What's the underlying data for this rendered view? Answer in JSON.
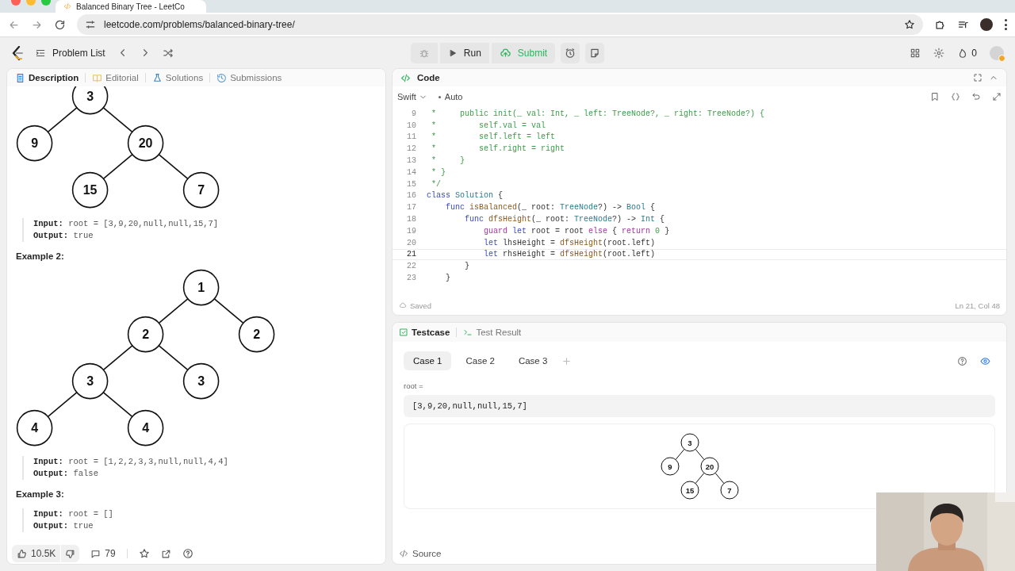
{
  "browser": {
    "tab_title": "Balanced Binary Tree - LeetCo",
    "url": "leetcode.com/problems/balanced-binary-tree/"
  },
  "navbar": {
    "problem_list": "Problem List",
    "run": "Run",
    "submit": "Submit",
    "streak": "0"
  },
  "description": {
    "tabs": [
      {
        "label": "Description",
        "selected": true
      },
      {
        "label": "Editorial",
        "selected": false
      },
      {
        "label": "Solutions",
        "selected": false
      },
      {
        "label": "Submissions",
        "selected": false
      }
    ],
    "examples": [
      {
        "tree": {
          "value": "3",
          "children": [
            {
              "value": "9"
            },
            {
              "value": "20",
              "children": [
                {
                  "value": "15"
                },
                {
                  "value": "7"
                }
              ]
            }
          ]
        },
        "input_label": "Input:",
        "input": "root = [3,9,20,null,null,15,7]",
        "output_label": "Output:",
        "output": "true"
      },
      {
        "heading": "Example 2:",
        "tree": {
          "value": "1",
          "children": [
            {
              "value": "2",
              "children": [
                {
                  "value": "3",
                  "children": [
                    {
                      "value": "4"
                    },
                    {
                      "value": "4"
                    }
                  ]
                },
                {
                  "value": "3"
                }
              ]
            },
            {
              "value": "2"
            }
          ]
        },
        "input_label": "Input:",
        "input": "root = [1,2,2,3,3,null,null,4,4]",
        "output_label": "Output:",
        "output": "false"
      },
      {
        "heading": "Example 3:",
        "input_label": "Input:",
        "input": "root = []",
        "output_label": "Output:",
        "output": "true"
      }
    ],
    "likes": "10.5K",
    "comments": "79"
  },
  "editor": {
    "title": "Code",
    "language": "Swift",
    "mode": "Auto",
    "status": "Saved",
    "cursor": "Ln 21, Col 48",
    "lines": [
      {
        "number": "9",
        "current": false,
        "segments": [
          {
            "text": " *     public init(_ val: Int, _ left: TreeNode?, _ right: TreeNode?) {",
            "kind": "comment"
          }
        ]
      },
      {
        "number": "10",
        "current": false,
        "segments": [
          {
            "text": " *         self.val = val",
            "kind": "comment"
          }
        ]
      },
      {
        "number": "11",
        "current": false,
        "segments": [
          {
            "text": " *         self.left = left",
            "kind": "comment"
          }
        ]
      },
      {
        "number": "12",
        "current": false,
        "segments": [
          {
            "text": " *         self.right = right",
            "kind": "comment"
          }
        ]
      },
      {
        "number": "13",
        "current": false,
        "segments": [
          {
            "text": " *     }",
            "kind": "comment"
          }
        ]
      },
      {
        "number": "14",
        "current": false,
        "segments": [
          {
            "text": " * }",
            "kind": "comment"
          }
        ]
      },
      {
        "number": "15",
        "current": false,
        "segments": [
          {
            "text": " */",
            "kind": "comment"
          }
        ]
      },
      {
        "number": "16",
        "current": false,
        "segments": [
          {
            "text": "class",
            "kind": "keyword"
          },
          {
            "text": " Solution",
            "kind": "type"
          },
          {
            "text": " {",
            "kind": "plain"
          }
        ]
      },
      {
        "number": "17",
        "current": false,
        "segments": [
          {
            "text": "    func",
            "kind": "keyword"
          },
          {
            "text": " isBalanced",
            "kind": "function"
          },
          {
            "text": "(_ root: ",
            "kind": "plain"
          },
          {
            "text": "TreeNode",
            "kind": "type"
          },
          {
            "text": "?) -> ",
            "kind": "plain"
          },
          {
            "text": "Bool",
            "kind": "type"
          },
          {
            "text": " {",
            "kind": "plain"
          }
        ]
      },
      {
        "number": "18",
        "current": false,
        "segments": [
          {
            "text": "        func",
            "kind": "keyword"
          },
          {
            "text": " dfsHeight",
            "kind": "function"
          },
          {
            "text": "(_ root: ",
            "kind": "plain"
          },
          {
            "text": "TreeNode",
            "kind": "type"
          },
          {
            "text": "?) -> ",
            "kind": "plain"
          },
          {
            "text": "Int",
            "kind": "type"
          },
          {
            "text": " {",
            "kind": "plain"
          }
        ]
      },
      {
        "number": "19",
        "current": false,
        "segments": [
          {
            "text": "            guard",
            "kind": "control"
          },
          {
            "text": " let",
            "kind": "keyword"
          },
          {
            "text": " root = root ",
            "kind": "plain"
          },
          {
            "text": "else",
            "kind": "control"
          },
          {
            "text": " { ",
            "kind": "plain"
          },
          {
            "text": "return",
            "kind": "control"
          },
          {
            "text": " 0",
            "kind": "number"
          },
          {
            "text": " }",
            "kind": "plain"
          }
        ]
      },
      {
        "number": "20",
        "current": false,
        "segments": [
          {
            "text": "            let",
            "kind": "keyword"
          },
          {
            "text": " lhsHeight = ",
            "kind": "plain"
          },
          {
            "text": "dfsHeight",
            "kind": "function"
          },
          {
            "text": "(root.left)",
            "kind": "plain"
          }
        ]
      },
      {
        "number": "21",
        "current": true,
        "segments": [
          {
            "text": "            let",
            "kind": "keyword"
          },
          {
            "text": " rhsHeight = ",
            "kind": "plain"
          },
          {
            "text": "dfsHeight",
            "kind": "function"
          },
          {
            "text": "(root.left)",
            "kind": "plain"
          }
        ]
      },
      {
        "number": "22",
        "current": false,
        "segments": [
          {
            "text": "        }",
            "kind": "plain"
          }
        ]
      },
      {
        "number": "23",
        "current": false,
        "segments": [
          {
            "text": "    }",
            "kind": "plain"
          }
        ]
      }
    ]
  },
  "testcase": {
    "tabs": [
      {
        "label": "Testcase",
        "selected": true
      },
      {
        "label": "Test Result",
        "selected": false
      }
    ],
    "cases": [
      {
        "label": "Case 1",
        "selected": true
      },
      {
        "label": "Case 2",
        "selected": false
      },
      {
        "label": "Case 3",
        "selected": false
      }
    ],
    "param_label": "root =",
    "value": "[3,9,20,null,null,15,7]",
    "tree": {
      "value": "3",
      "children": [
        {
          "value": "9"
        },
        {
          "value": "20",
          "children": [
            {
              "value": "15"
            },
            {
              "value": "7"
            }
          ]
        }
      ]
    },
    "source": "Source"
  }
}
